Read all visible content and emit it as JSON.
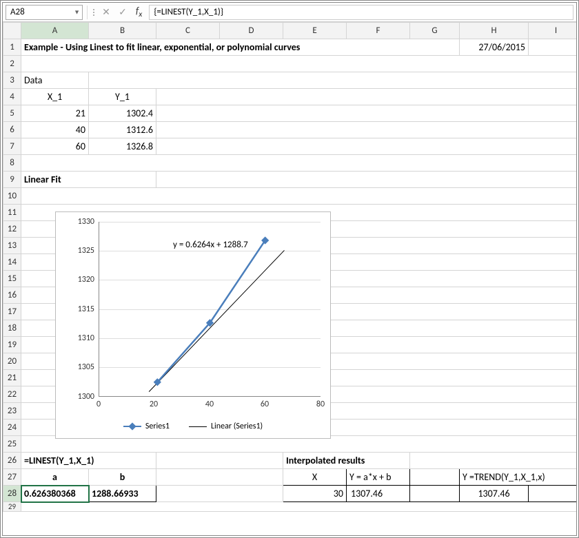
{
  "namebox": "A28",
  "formula": "{=LINEST(Y_1,X_1)}",
  "cols": [
    "A",
    "B",
    "C",
    "D",
    "E",
    "F",
    "G",
    "H",
    "I"
  ],
  "cells": {
    "title": "Example - Using Linest to fit linear, exponential, or polynomial curves",
    "date": "27/06/2015",
    "data_label": "Data",
    "x1_hdr": "X_1",
    "y1_hdr": "Y_1",
    "x_vals": [
      "21",
      "40",
      "60"
    ],
    "y_vals": [
      "1302.4",
      "1312.6",
      "1326.8"
    ],
    "linear_fit": "Linear Fit",
    "linest_formula": "=LINEST(Y_1,X_1)",
    "a_hdr": "a",
    "b_hdr": "b",
    "a_val": "0.626380368",
    "b_val": "1288.66933",
    "interp_hdr": "Interpolated results",
    "X_hdr": "X",
    "yab_hdr": "Y = a*x + b",
    "trend_hdr": "Y =TREND(Y_1,X_1,x)",
    "xi": "30",
    "y1i": "1307.46",
    "y2i": "1307.46"
  },
  "chart_data": {
    "type": "scatter",
    "x": [
      21,
      40,
      60
    ],
    "y": [
      1302.4,
      1312.6,
      1326.8
    ],
    "equation": "y = 0.6264x + 1288.7",
    "xlim": [
      0,
      80
    ],
    "ylim": [
      1300,
      1330
    ],
    "xticks": [
      0,
      20,
      40,
      60,
      80
    ],
    "yticks": [
      1300,
      1305,
      1310,
      1315,
      1320,
      1325,
      1330
    ],
    "legend": [
      "Series1",
      "Linear (Series1)"
    ],
    "trendline": {
      "slope": 0.6264,
      "intercept": 1288.7
    }
  }
}
